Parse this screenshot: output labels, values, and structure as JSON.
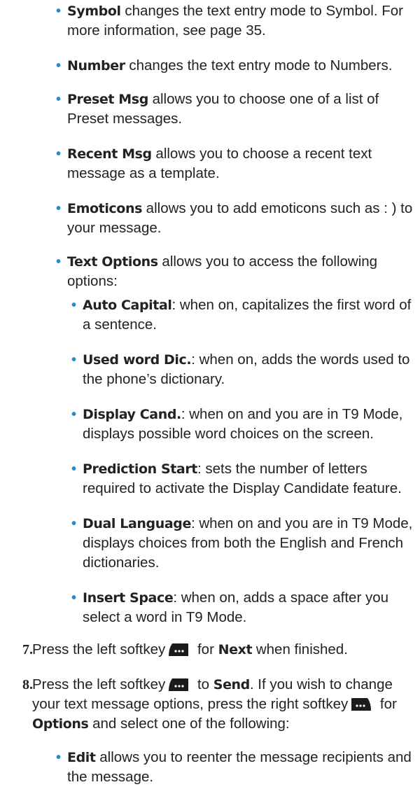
{
  "items": [
    {
      "term": "Symbol",
      "rest": " changes the text entry mode to Symbol. For more information, see page 35."
    },
    {
      "term": "Number",
      "rest": " changes the text entry mode to Numbers."
    },
    {
      "term": "Preset Msg",
      "rest": " allows you to choose one of a list of Preset messages."
    },
    {
      "term": "Recent Msg",
      "rest": " allows you to choose a recent text message as a template."
    },
    {
      "term": "Emoticons",
      "rest": " allows you to add emoticons such as : ) to your message."
    },
    {
      "term": "Text Options",
      "rest": " allows you to access the following options:"
    }
  ],
  "sub_items": [
    {
      "term": "Auto Capital",
      "rest": ": when on, capitalizes the first word of a sentence."
    },
    {
      "term": "Used word Dic.",
      "rest": ": when on, adds the words used to the phone’s dictionary."
    },
    {
      "term": "Display Cand.",
      "rest": ": when on and you are in T9 Mode, displays possible word choices on the screen."
    },
    {
      "term": "Prediction Start",
      "rest": ": sets the number of letters required to activate the Display Candidate feature."
    },
    {
      "term": "Dual Language",
      "rest": ": when on and you are in T9 Mode, displays choices from both the English and French dictionaries."
    },
    {
      "term": "Insert Space",
      "rest": ": when on, adds a space after you select a word in T9 Mode."
    }
  ],
  "step7": {
    "number": "7.",
    "part1": "Press the left softkey",
    "part2": " for ",
    "term": "Next",
    "part3": " when finished."
  },
  "step8": {
    "number": "8.",
    "part1": "Press the left softkey",
    "part2": " to ",
    "term1": "Send",
    "part3": ". If you wish to change your text message options, press the right softkey",
    "part4": " for ",
    "term2": "Options",
    "part5": " and select one of the following:"
  },
  "last_item": {
    "term": "Edit",
    "rest": " allows you to reenter the message recipients and the message."
  },
  "softkey_icons": {
    "left": "left-softkey-icon",
    "right": "right-softkey-icon"
  },
  "colors": {
    "bullet": "#1d8fd1",
    "text": "#222222"
  }
}
